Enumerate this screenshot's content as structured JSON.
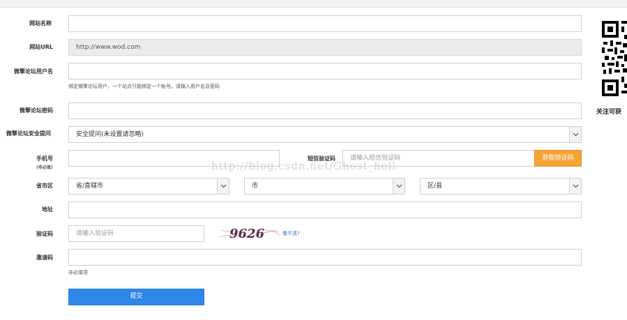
{
  "form": {
    "site_name": {
      "label": "网站名称",
      "value": ""
    },
    "site_url": {
      "label": "网站URL",
      "value": "http://www.wod.com"
    },
    "forum_user": {
      "label": "微擎论坛用户名",
      "value": "",
      "hint": "绑定微擎论坛用户，一个站点只能绑定一个帐号。请输入用户名及密码"
    },
    "forum_password": {
      "label": "微擎论坛密码",
      "value": ""
    },
    "security_question": {
      "label": "微擎论坛安全提问",
      "selected": "安全提问(未设置请忽略)"
    },
    "phone": {
      "label": "手机号",
      "sublabel": "(非必填)",
      "value": ""
    },
    "sms_code": {
      "label": "短信验证码",
      "placeholder": "请输入短信验证码",
      "button": "获取验证码"
    },
    "region": {
      "label": "省市区",
      "province": "省/直辖市",
      "city": "市",
      "district": "区/县"
    },
    "address": {
      "label": "地址",
      "value": ""
    },
    "captcha": {
      "label": "验证码",
      "placeholder": "请输入验证码",
      "image_text": "9626",
      "refresh_link": "看不清?"
    },
    "invite_code": {
      "label": "邀请码",
      "value": "",
      "hint": "非必填项"
    },
    "submit_label": "提交"
  },
  "sidebar": {
    "qr_caption": "关注可获",
    "qr_icon": "qr-code-icon"
  },
  "watermark": "http://blog.csdn.net/Ghost_hell",
  "colors": {
    "sms_button": "#f5a536",
    "submit_button": "#2f86ea",
    "link": "#2a6fc7"
  }
}
